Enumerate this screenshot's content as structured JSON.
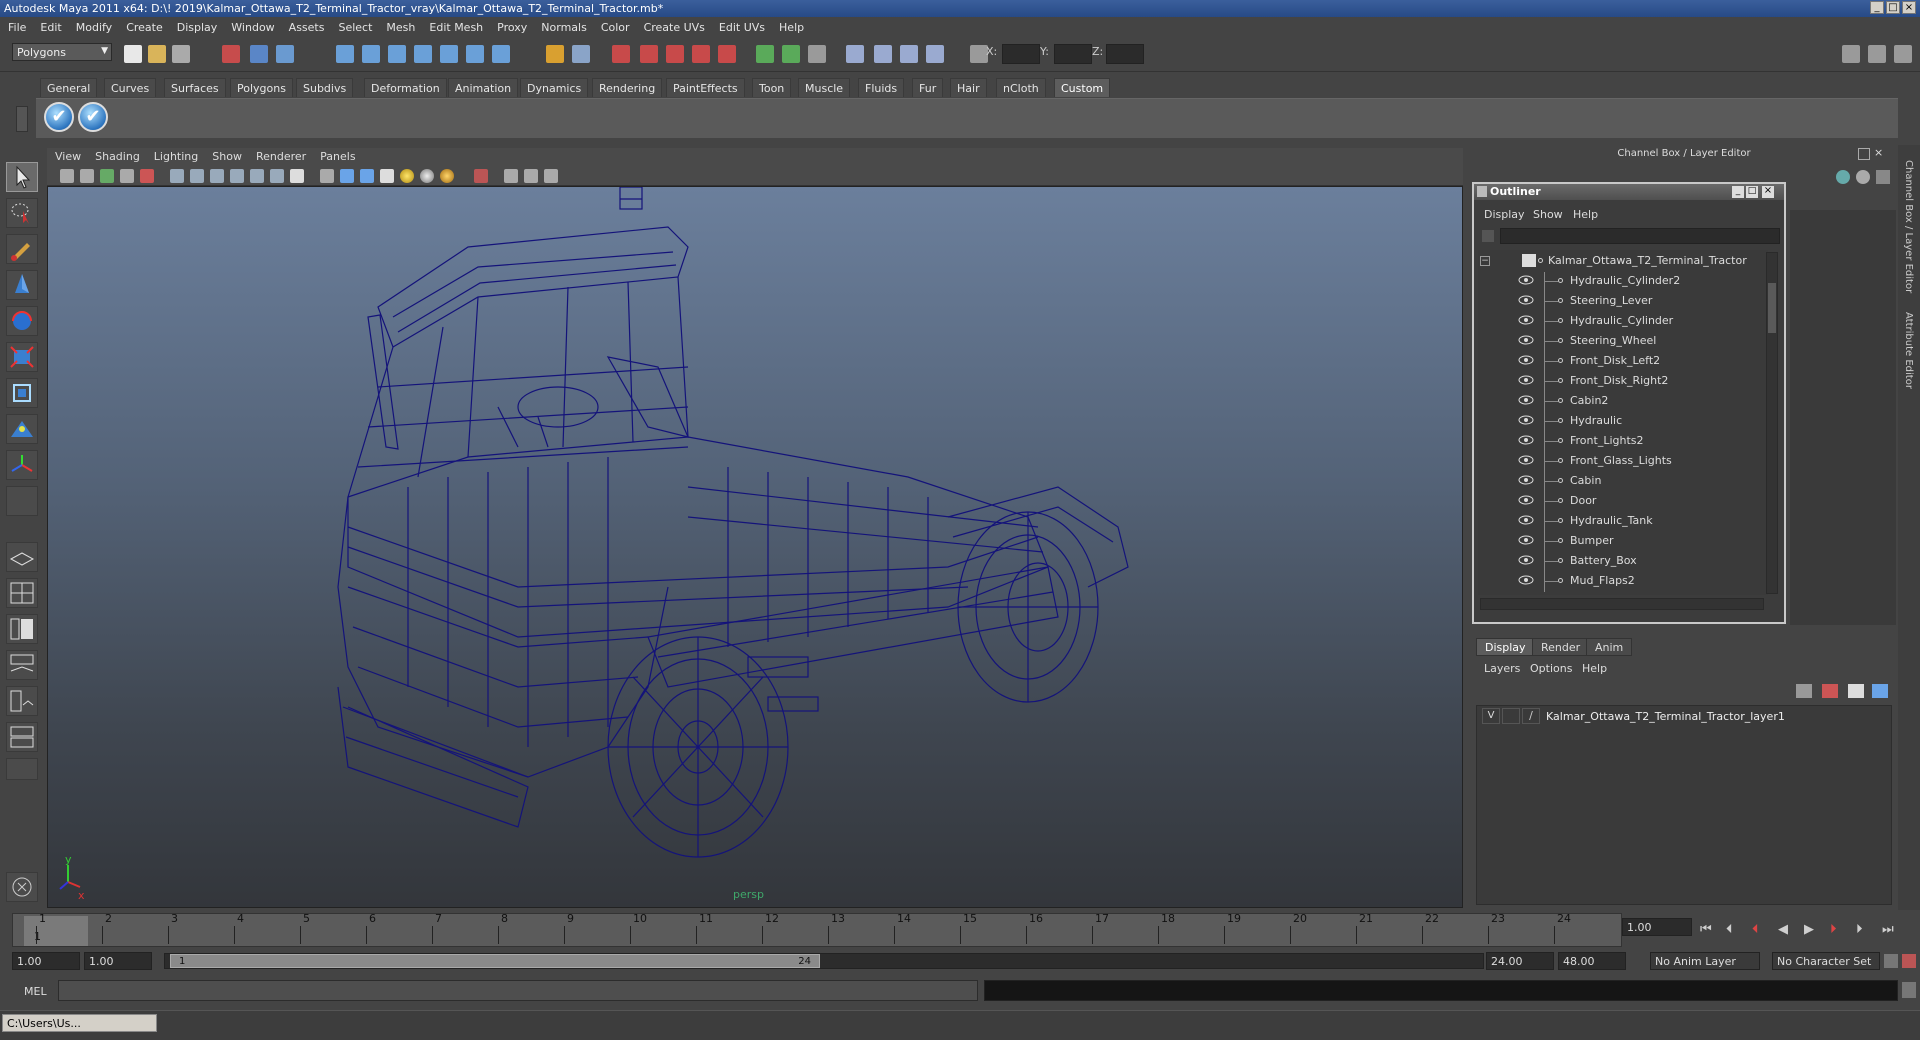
{
  "window": {
    "title": "Autodesk Maya 2011 x64: D:\\! 2019\\Kalmar_Ottawa_T2_Terminal_Tractor_vray\\Kalmar_Ottawa_T2_Terminal_Tractor.mb*"
  },
  "menubar": [
    "File",
    "Edit",
    "Modify",
    "Create",
    "Display",
    "Window",
    "Assets",
    "Select",
    "Mesh",
    "Edit Mesh",
    "Proxy",
    "Normals",
    "Color",
    "Create UVs",
    "Edit UVs",
    "Help"
  ],
  "status": {
    "mode": "Polygons",
    "x_label": "X:",
    "y_label": "Y:",
    "z_label": "Z:"
  },
  "shelf": {
    "tabs": [
      "General",
      "Curves",
      "Surfaces",
      "Polygons",
      "Subdivs",
      "Deformation",
      "Animation",
      "Dynamics",
      "Rendering",
      "PaintEffects",
      "Toon",
      "Muscle",
      "Fluids",
      "Fur",
      "Hair",
      "nCloth",
      "Custom"
    ],
    "active": "Custom",
    "button_glyph": "✔"
  },
  "viewport": {
    "menu": [
      "View",
      "Shading",
      "Lighting",
      "Show",
      "Renderer",
      "Panels"
    ],
    "camera_label": "persp",
    "axis_y": "y",
    "axis_x": "x",
    "wire_color": "#14137a"
  },
  "channel_box": {
    "title": "Channel Box / Layer Editor",
    "side_label_1": "Channel Box / Layer Editor",
    "side_label_2": "Attribute Editor"
  },
  "outliner": {
    "title": "Outliner",
    "menu": [
      "Display",
      "Show",
      "Help"
    ],
    "root": "Kalmar_Ottawa_T2_Terminal_Tractor",
    "items": [
      "Hydraulic_Cylinder2",
      "Steering_Lever",
      "Hydraulic_Cylinder",
      "Steering_Wheel",
      "Front_Disk_Left2",
      "Front_Disk_Right2",
      "Cabin2",
      "Hydraulic",
      "Front_Lights2",
      "Front_Glass_Lights",
      "Cabin",
      "Door",
      "Hydraulic_Tank",
      "Bumper",
      "Battery_Box",
      "Mud_Flaps2"
    ]
  },
  "layer_editor": {
    "tabs": [
      "Display",
      "Render",
      "Anim"
    ],
    "active": "Display",
    "menu": [
      "Layers",
      "Options",
      "Help"
    ],
    "layer_visible": "V",
    "layer_name": "Kalmar_Ottawa_T2_Terminal_Tractor_layer1"
  },
  "timeline": {
    "ticks": [
      "1",
      "2",
      "3",
      "4",
      "5",
      "6",
      "7",
      "8",
      "9",
      "10",
      "11",
      "12",
      "13",
      "14",
      "15",
      "16",
      "17",
      "18",
      "19",
      "20",
      "21",
      "22",
      "23",
      "24"
    ],
    "current_marker": "1",
    "current_frame": "1.00"
  },
  "range": {
    "start_time": "1.00",
    "playback_start": "1.00",
    "handle_start": "1",
    "handle_end": "24",
    "playback_end": "24.00",
    "end_time": "48.00",
    "anim_layer": "No Anim Layer",
    "character_set": "No Character Set"
  },
  "command_line": {
    "label": "MEL"
  },
  "taskbar": {
    "item": "C:\\Users\\Us..."
  }
}
